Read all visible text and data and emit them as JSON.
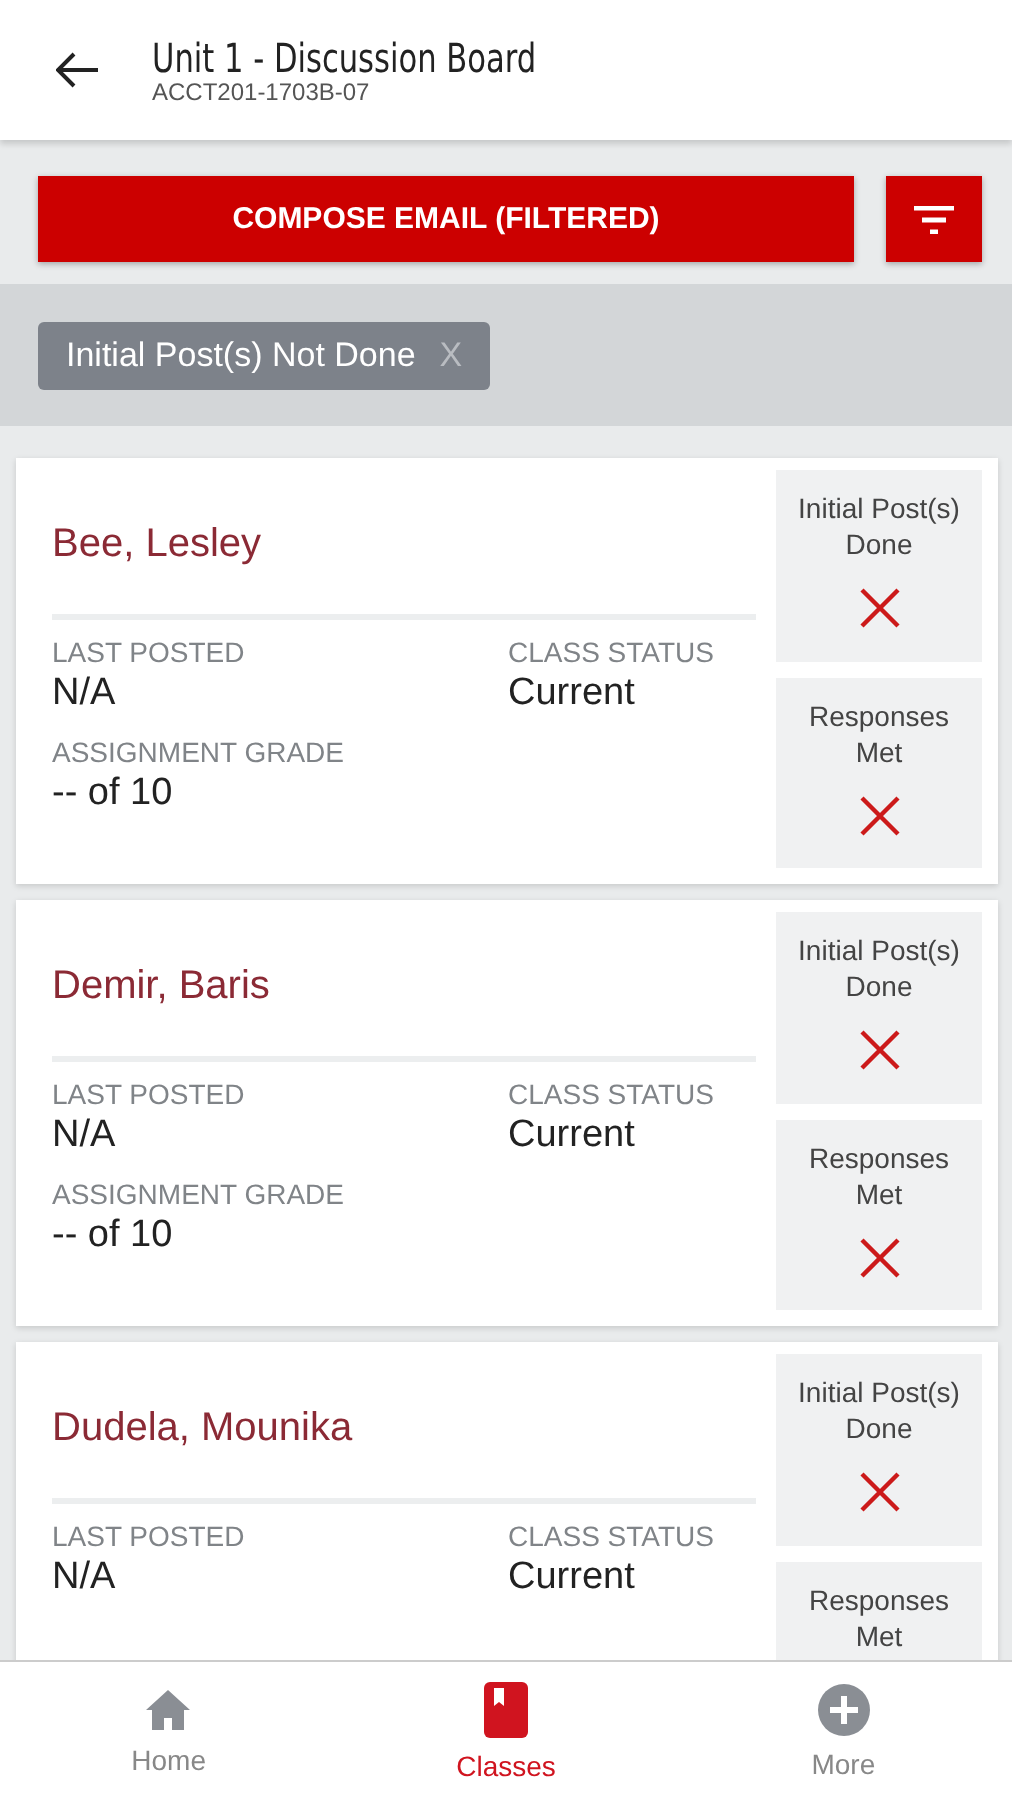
{
  "header": {
    "title": "Unit 1 - Discussion Board",
    "subtitle": "ACCT201-1703B-07"
  },
  "compose_button": "COMPOSE EMAIL (FILTERED)",
  "filters": [
    {
      "label": "Initial Post(s) Not Done",
      "remove": "X"
    }
  ],
  "students": [
    {
      "name": "Bee, Lesley",
      "fields": [
        {
          "label": "LAST POSTED",
          "value": "N/A"
        },
        {
          "label": "CLASS STATUS",
          "value": "Current"
        },
        {
          "label": "ASSIGNMENT GRADE",
          "value": "-- of 10"
        }
      ],
      "checks": [
        {
          "label": "Initial Post(s) Done",
          "done": false
        },
        {
          "label": "Responses Met",
          "done": false
        }
      ]
    },
    {
      "name": "Demir, Baris",
      "fields": [
        {
          "label": "LAST POSTED",
          "value": "N/A"
        },
        {
          "label": "CLASS STATUS",
          "value": "Current"
        },
        {
          "label": "ASSIGNMENT GRADE",
          "value": "-- of 10"
        }
      ],
      "checks": [
        {
          "label": "Initial Post(s) Done",
          "done": false
        },
        {
          "label": "Responses Met",
          "done": false
        }
      ]
    },
    {
      "name": "Dudela, Mounika",
      "fields": [
        {
          "label": "LAST POSTED",
          "value": "N/A"
        },
        {
          "label": "CLASS STATUS",
          "value": "Current"
        }
      ],
      "checks": [
        {
          "label": "Initial Post(s) Done",
          "done": false
        },
        {
          "label": "Responses Met"
        }
      ]
    }
  ],
  "nav": [
    {
      "kind": "home",
      "label": "Home",
      "selected": false
    },
    {
      "kind": "classes",
      "label": "Classes",
      "selected": true
    },
    {
      "kind": "more",
      "label": "More",
      "selected": false
    }
  ]
}
